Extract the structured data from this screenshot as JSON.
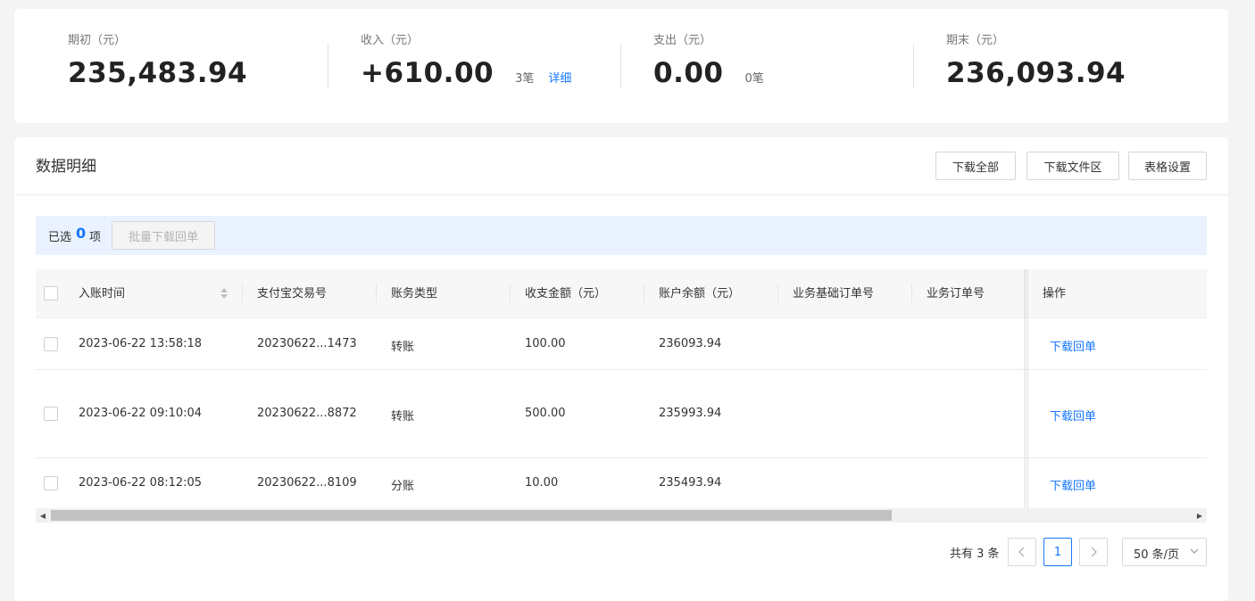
{
  "summary": {
    "opening": {
      "label": "期初（元）",
      "value": "235,483.94"
    },
    "income": {
      "label": "收入（元）",
      "value": "+610.00",
      "count": "3笔",
      "detail_link": "详细"
    },
    "expense": {
      "label": "支出（元）",
      "value": "0.00",
      "count": "0笔"
    },
    "closing": {
      "label": "期末（元）",
      "value": "236,093.94"
    }
  },
  "panel": {
    "title": "数据明细",
    "buttons": {
      "download_all": "下载全部",
      "download_files": "下载文件区",
      "table_settings": "表格设置"
    }
  },
  "selection": {
    "prefix": "已选",
    "count": "0",
    "suffix": "项",
    "batch_button": "批量下载回单"
  },
  "table": {
    "headers": {
      "time": "入账时间",
      "trade_no": "支付宝交易号",
      "type": "账务类型",
      "amount": "收支金额（元）",
      "balance": "账户余额（元）",
      "base_order": "业务基础订单号",
      "order": "业务订单号",
      "action": "操作"
    },
    "rows": [
      {
        "time": "2023-06-22 13:58:18",
        "trade_no": "20230622...1473",
        "type": "转账",
        "amount": "100.00",
        "balance": "236093.94",
        "base_order": "",
        "order": "",
        "action": "下载回单"
      },
      {
        "time": "2023-06-22 09:10:04",
        "trade_no": "20230622...8872",
        "type": "转账",
        "amount": "500.00",
        "balance": "235993.94",
        "base_order": "",
        "order": "",
        "action": "下载回单"
      },
      {
        "time": "2023-06-22 08:12:05",
        "trade_no": "20230622...8109",
        "type": "分账",
        "amount": "10.00",
        "balance": "235493.94",
        "base_order": "",
        "order": "",
        "action": "下载回单"
      }
    ]
  },
  "pagination": {
    "total": "共有 3 条",
    "current_page": "1",
    "page_size": "50 条/页"
  },
  "colors": {
    "accent": "#1677ff",
    "selection_bg": "#e9f2fe",
    "page_bg": "#f4f4f4"
  },
  "icons": [
    "sort-icon",
    "checkbox-icon",
    "scroll-left-icon",
    "scroll-right-icon",
    "prev-page-icon",
    "next-page-icon",
    "chevron-down-icon"
  ]
}
